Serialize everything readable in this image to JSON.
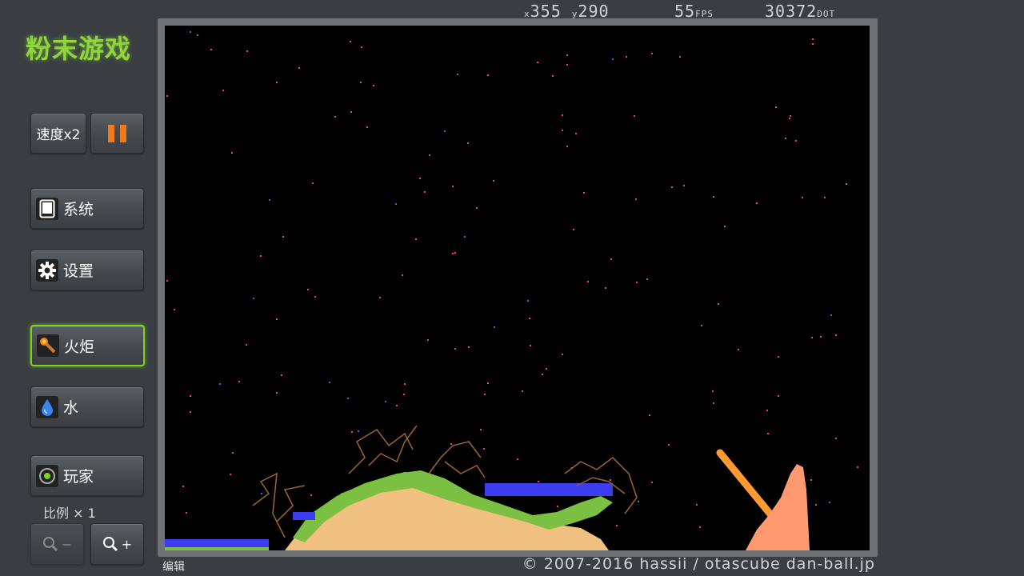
{
  "title": "粉末游戏",
  "hud": {
    "x_label": "x",
    "x_value": "355",
    "y_label": "y",
    "y_value": "290",
    "fps_value": "55",
    "fps_label": "FPS",
    "dot_value": "30372",
    "dot_label": "DOT"
  },
  "buttons": {
    "speed": "速度x2",
    "system": "系统",
    "settings": "设置",
    "torch": "火炬",
    "water": "水",
    "player": "玩家",
    "zoom_out": "−",
    "zoom_in": "+"
  },
  "scale_label": "比例 × 1",
  "footer": {
    "edit": "编辑",
    "copyright": "© 2007-2016 hassii / otascube dan-ball.jp"
  },
  "colors": {
    "accent_green": "#8fd63a",
    "pause_orange": "#f07a1a",
    "sand": "#f0c080",
    "plant": "#7cc043",
    "water": "#3c3cf0",
    "wood": "#a0642c",
    "torch": "#ff9a30",
    "fire": "#ff9a70",
    "spark": "#ff3c6e"
  },
  "icons": [
    "pause-icon",
    "tablet-icon",
    "gear-icon",
    "torch-icon",
    "water-drop-icon",
    "player-icon",
    "zoom-out-icon",
    "zoom-in-icon"
  ]
}
